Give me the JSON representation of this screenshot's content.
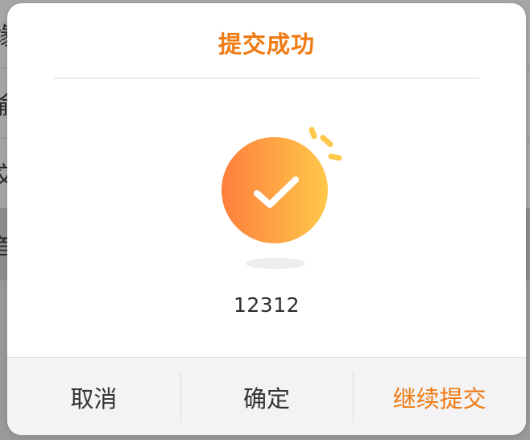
{
  "background": {
    "rows": [
      "缘",
      "偷",
      "交",
      "首"
    ]
  },
  "dialog": {
    "title": "提交成功",
    "message": "12312",
    "buttons": {
      "cancel": "取消",
      "confirm": "确定",
      "continue": "继续提交"
    }
  },
  "colors": {
    "accent": "#f07a12",
    "gradient_start": "#fe7f3d",
    "gradient_end": "#ffc84a",
    "overlay": "#9a9a9a"
  },
  "icons": {
    "success": "check-circle-icon"
  }
}
